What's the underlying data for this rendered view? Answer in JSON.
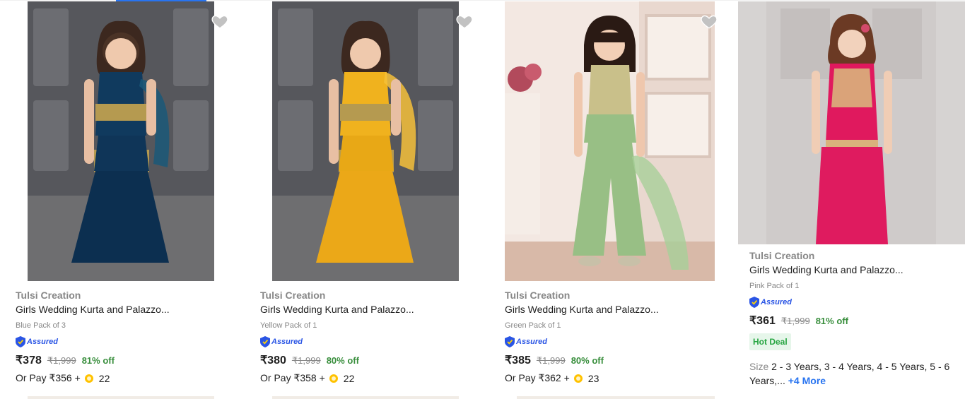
{
  "products": [
    {
      "brand": "Tulsi Creation",
      "title": "Girls Wedding Kurta and Palazzo...",
      "variant": "Blue Pack of 3",
      "assured": "Assured",
      "price": "₹378",
      "mrp": "₹1,999",
      "discount": "81% off",
      "pay_prefix": "Or Pay ₹356 +",
      "coins": "22",
      "dress_color": "#103a5e",
      "accent_color": "#b59a50"
    },
    {
      "brand": "Tulsi Creation",
      "title": "Girls Wedding Kurta and Palazzo...",
      "variant": "Yellow Pack of 1",
      "assured": "Assured",
      "price": "₹380",
      "mrp": "₹1,999",
      "discount": "80% off",
      "pay_prefix": "Or Pay ₹358 +",
      "coins": "22",
      "dress_color": "#f0b21e",
      "accent_color": "#b59a50"
    },
    {
      "brand": "Tulsi Creation",
      "title": "Girls Wedding Kurta and Palazzo...",
      "variant": "Green Pack of 1",
      "assured": "Assured",
      "price": "₹385",
      "mrp": "₹1,999",
      "discount": "80% off",
      "pay_prefix": "Or Pay ₹362 +",
      "coins": "23",
      "dress_color": "#98bf85",
      "accent_color": "#c9c08a"
    },
    {
      "brand": "Tulsi Creation",
      "title": "Girls Wedding Kurta and Palazzo...",
      "variant": "Pink Pack of 1",
      "assured": "Assured",
      "price": "₹361",
      "mrp": "₹1,999",
      "discount": "81% off",
      "hot_deal": "Hot Deal",
      "size_label": "Size",
      "sizes": "2 - 3 Years, 3 - 4 Years, 4 - 5 Years, 5 - 6 Years,...",
      "more": "+4 More",
      "dress_color": "#e0195e",
      "accent_color": "#d9b27c"
    }
  ],
  "icons": {
    "wishlist": "heart-icon",
    "assured": "assured-shield-icon",
    "coin": "supercoin-icon"
  },
  "colors": {
    "discount": "#388e3c",
    "assured_text": "#2a55e5",
    "link": "#2874f0"
  }
}
